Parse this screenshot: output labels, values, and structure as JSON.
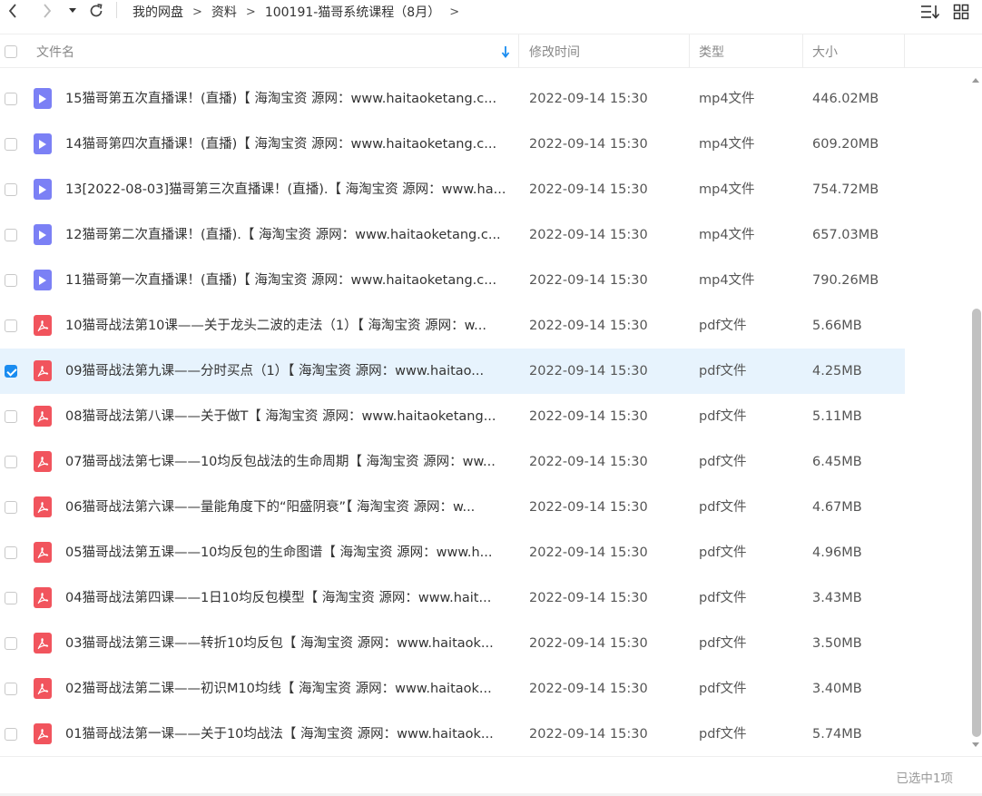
{
  "toolbar": {
    "back_icon": "chevron-left-icon",
    "forward_icon": "chevron-right-icon",
    "history_icon": "caret-down-icon",
    "refresh_icon": "refresh-icon",
    "breadcrumb": [
      "我的网盘",
      "资料",
      "100191-猫哥系统课程（8月）"
    ],
    "sort_icon": "sort-list-icon",
    "view_icon": "grid-view-icon"
  },
  "header": {
    "name": "文件名",
    "modified": "修改时间",
    "type": "类型",
    "size": "大小",
    "sort_indicator": "sort-down-arrow-icon"
  },
  "files": [
    {
      "name": "15猫哥第五次直播课！(直播)【 海淘宝资 源网：www.haitaoketang.c...",
      "date": "2022-09-14 15:30",
      "type": "mp4文件",
      "size": "446.02MB",
      "kind": "video",
      "selected": false
    },
    {
      "name": "14猫哥第四次直播课！(直播)【 海淘宝资 源网：www.haitaoketang.c...",
      "date": "2022-09-14 15:30",
      "type": "mp4文件",
      "size": "609.20MB",
      "kind": "video",
      "selected": false
    },
    {
      "name": "13[2022-08-03]猫哥第三次直播课！(直播).【 海淘宝资 源网：www.ha...",
      "date": "2022-09-14 15:30",
      "type": "mp4文件",
      "size": "754.72MB",
      "kind": "video",
      "selected": false
    },
    {
      "name": "12猫哥第二次直播课！(直播).【 海淘宝资 源网：www.haitaoketang.c...",
      "date": "2022-09-14 15:30",
      "type": "mp4文件",
      "size": "657.03MB",
      "kind": "video",
      "selected": false
    },
    {
      "name": "11猫哥第一次直播课！(直播)【 海淘宝资 源网：www.haitaoketang.c...",
      "date": "2022-09-14 15:30",
      "type": "mp4文件",
      "size": "790.26MB",
      "kind": "video",
      "selected": false
    },
    {
      "name": "10猫哥战法第10课——关于龙头二波的走法（1）【 海淘宝资 源网：w...",
      "date": "2022-09-14 15:30",
      "type": "pdf文件",
      "size": "5.66MB",
      "kind": "pdf",
      "selected": false
    },
    {
      "name": "09猫哥战法第九课——分时买点（1）【 海淘宝资 源网：www.haitao...",
      "date": "2022-09-14 15:30",
      "type": "pdf文件",
      "size": "4.25MB",
      "kind": "pdf",
      "selected": true
    },
    {
      "name": "08猫哥战法第八课——关于做T【 海淘宝资 源网：www.haitaoketang...",
      "date": "2022-09-14 15:30",
      "type": "pdf文件",
      "size": "5.11MB",
      "kind": "pdf",
      "selected": false
    },
    {
      "name": "07猫哥战法第七课——10均反包战法的生命周期【 海淘宝资 源网：ww...",
      "date": "2022-09-14 15:30",
      "type": "pdf文件",
      "size": "6.45MB",
      "kind": "pdf",
      "selected": false
    },
    {
      "name": "06猫哥战法第六课——量能角度下的“阳盛阴衰”【 海淘宝资 源网：w...",
      "date": "2022-09-14 15:30",
      "type": "pdf文件",
      "size": "4.67MB",
      "kind": "pdf",
      "selected": false
    },
    {
      "name": "05猫哥战法第五课——10均反包的生命图谱【 海淘宝资 源网：www.h...",
      "date": "2022-09-14 15:30",
      "type": "pdf文件",
      "size": "4.96MB",
      "kind": "pdf",
      "selected": false
    },
    {
      "name": "04猫哥战法第四课——1日10均反包模型【 海淘宝资 源网：www.hait...",
      "date": "2022-09-14 15:30",
      "type": "pdf文件",
      "size": "3.43MB",
      "kind": "pdf",
      "selected": false
    },
    {
      "name": "03猫哥战法第三课——转折10均反包【 海淘宝资 源网：www.haitaok...",
      "date": "2022-09-14 15:30",
      "type": "pdf文件",
      "size": "3.50MB",
      "kind": "pdf",
      "selected": false
    },
    {
      "name": "02猫哥战法第二课——初识M10均线【 海淘宝资 源网：www.haitaok...",
      "date": "2022-09-14 15:30",
      "type": "pdf文件",
      "size": "3.40MB",
      "kind": "pdf",
      "selected": false
    },
    {
      "name": "01猫哥战法第一课——关于10均战法【 海淘宝资 源网：www.haitaok...",
      "date": "2022-09-14 15:30",
      "type": "pdf文件",
      "size": "5.74MB",
      "kind": "pdf",
      "selected": false
    }
  ],
  "footer": {
    "status": "已选中1项"
  },
  "colors": {
    "selected_row": "#e7f3fd",
    "checkbox_checked": "#1a8cf0",
    "video_icon": "#7b80f5",
    "pdf_icon": "#f1545d",
    "sort_arrow": "#1a8cf0"
  }
}
